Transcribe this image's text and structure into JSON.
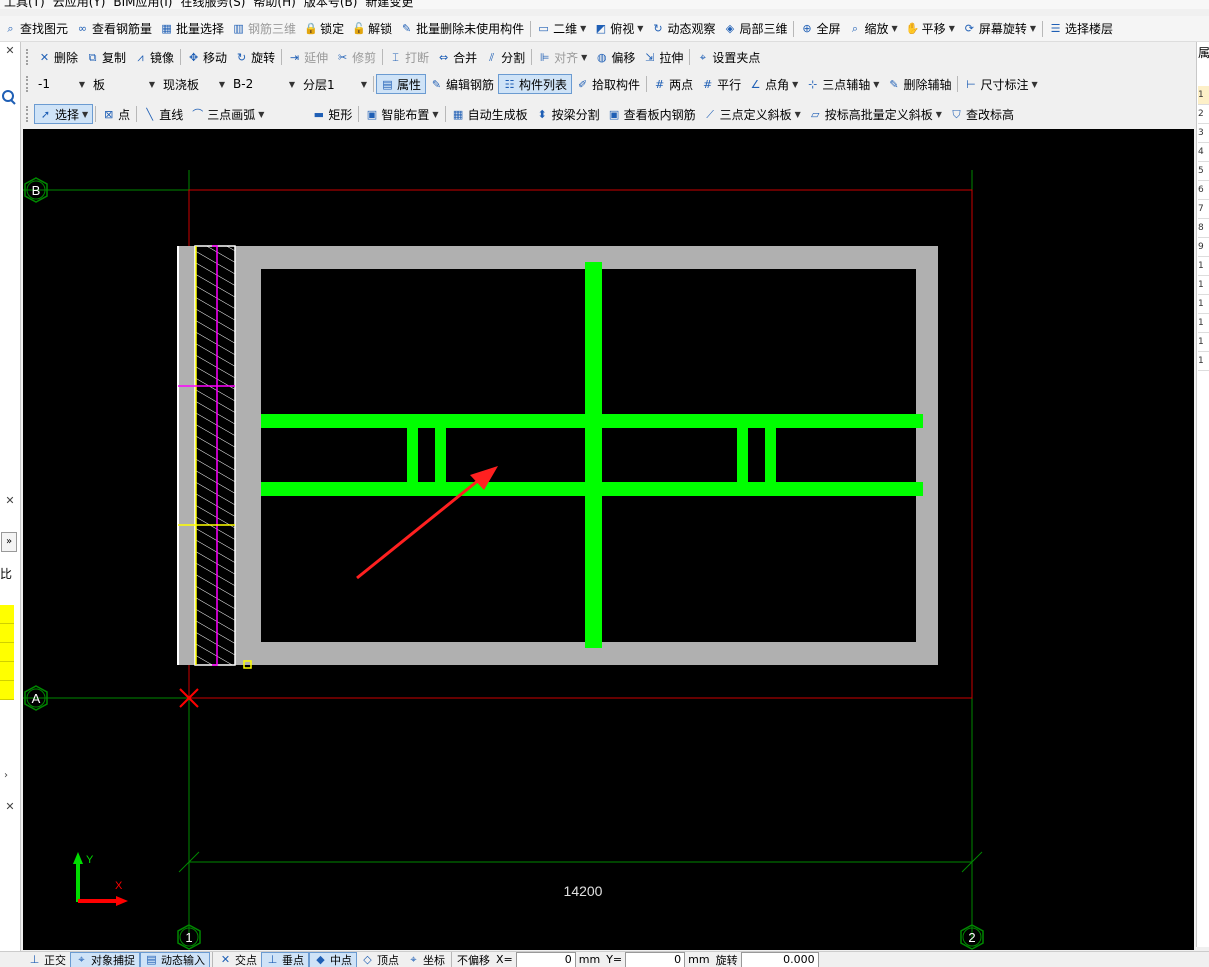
{
  "menubar": [
    "工具(T)",
    "云应用(Y)",
    "BIM应用(I)",
    "在线服务(S)",
    "帮助(H)",
    "版本号(B)",
    "新建变更"
  ],
  "toolbar1": [
    {
      "label": "查找图元",
      "icon": "binoculars-icon"
    },
    {
      "label": "查看钢筋量",
      "icon": "glasses-icon"
    },
    {
      "label": "批量选择",
      "icon": "grid-select-icon"
    },
    {
      "label": "钢筋三维",
      "icon": "rebar-3d-icon",
      "disabled": true
    },
    {
      "label": "锁定",
      "icon": "lock-icon"
    },
    {
      "label": "解锁",
      "icon": "unlock-icon"
    },
    {
      "label": "批量删除未使用构件",
      "icon": "brush-icon"
    },
    {
      "label": "二维",
      "icon": "square-icon",
      "dropdown": true
    },
    {
      "label": "俯视",
      "icon": "cube-icon",
      "dropdown": true
    },
    {
      "label": "动态观察",
      "icon": "orbit-icon"
    },
    {
      "label": "局部三维",
      "icon": "local-3d-icon"
    },
    {
      "label": "全屏",
      "icon": "zoom-full-icon"
    },
    {
      "label": "缩放",
      "icon": "zoom-icon",
      "dropdown": true
    },
    {
      "label": "平移",
      "icon": "pan-hand-icon",
      "dropdown": true
    },
    {
      "label": "屏幕旋转",
      "icon": "rotate-screen-icon",
      "dropdown": true
    },
    {
      "label": "选择楼层",
      "icon": "floor-select-icon"
    }
  ],
  "toolbar2": [
    {
      "label": "删除",
      "icon": "delete-icon"
    },
    {
      "label": "复制",
      "icon": "copy-icon"
    },
    {
      "label": "镜像",
      "icon": "mirror-icon"
    },
    {
      "label": "移动",
      "icon": "move-icon"
    },
    {
      "label": "旋转",
      "icon": "rotate-icon"
    },
    {
      "label": "延伸",
      "icon": "extend-icon",
      "disabled": true
    },
    {
      "label": "修剪",
      "icon": "trim-icon",
      "disabled": true
    },
    {
      "label": "打断",
      "icon": "break-icon",
      "disabled": true
    },
    {
      "label": "合并",
      "icon": "merge-icon"
    },
    {
      "label": "分割",
      "icon": "split-icon"
    },
    {
      "label": "对齐",
      "icon": "align-icon",
      "disabled": true,
      "dropdown": true
    },
    {
      "label": "偏移",
      "icon": "offset-icon"
    },
    {
      "label": "拉伸",
      "icon": "stretch-icon"
    },
    {
      "label": "设置夹点",
      "icon": "grip-point-icon"
    }
  ],
  "toolbar3": {
    "floor": "-1",
    "category": "板",
    "type": "现浇板",
    "component": "B-2",
    "layer": "分层1",
    "buttons": [
      {
        "label": "属性",
        "icon": "properties-icon",
        "active": true
      },
      {
        "label": "编辑钢筋",
        "icon": "edit-rebar-icon"
      },
      {
        "label": "构件列表",
        "icon": "component-list-icon",
        "active": true
      },
      {
        "label": "拾取构件",
        "icon": "pick-icon"
      },
      {
        "label": "两点",
        "icon": "two-point-icon"
      },
      {
        "label": "平行",
        "icon": "parallel-icon"
      },
      {
        "label": "点角",
        "icon": "point-angle-icon",
        "dropdown": true
      },
      {
        "label": "三点辅轴",
        "icon": "three-point-axis-icon",
        "dropdown": true
      },
      {
        "label": "删除辅轴",
        "icon": "delete-axis-icon"
      },
      {
        "label": "尺寸标注",
        "icon": "dimension-icon",
        "dropdown": true
      }
    ]
  },
  "toolbar4": [
    {
      "label": "选择",
      "icon": "cursor-icon",
      "active": true,
      "dropdown": true
    },
    {
      "label": "点",
      "icon": "point-icon"
    },
    {
      "label": "直线",
      "icon": "line-icon"
    },
    {
      "label": "三点画弧",
      "icon": "arc-icon",
      "dropdown": true
    },
    {
      "label": "矩形",
      "icon": "rectangle-icon"
    },
    {
      "label": "智能布置",
      "icon": "smart-layout-icon",
      "dropdown": true
    },
    {
      "label": "自动生成板",
      "icon": "auto-slab-icon"
    },
    {
      "label": "按梁分割",
      "icon": "beam-split-icon"
    },
    {
      "label": "查看板内钢筋",
      "icon": "view-rebar-icon"
    },
    {
      "label": "三点定义斜板",
      "icon": "slope-slab-icon",
      "dropdown": true
    },
    {
      "label": "按标高批量定义斜板",
      "icon": "batch-slope-icon",
      "dropdown": true
    },
    {
      "label": "查改标高",
      "icon": "elevation-icon"
    }
  ],
  "drawing": {
    "axis_labels": {
      "b": "B",
      "a": "A",
      "one": "1",
      "two": "2"
    },
    "dimension": "14200",
    "ucs": {
      "y": "Y",
      "x": "X"
    },
    "colors": {
      "background": "#000000",
      "slab": "#b0b0b0",
      "rebar": "#00ff00",
      "grid": "#008800",
      "boundary": "#cc0000",
      "arrow": "#ff2020",
      "hatch": "#ffffff",
      "magenta": "#ff00ff",
      "yellow": "#ffff00"
    }
  },
  "left_panel": {
    "expand": "»",
    "label": "比"
  },
  "right_panel": {
    "header": "属",
    "rows": [
      "1",
      "2",
      "3",
      "4",
      "5",
      "6",
      "7",
      "8",
      "9",
      "1",
      "1",
      "1",
      "1",
      "1",
      "1"
    ]
  },
  "statusbar": {
    "items": [
      {
        "label": "正交",
        "icon": "ortho-icon"
      },
      {
        "label": "对象捕捉",
        "icon": "snap-icon",
        "active": true
      },
      {
        "label": "动态输入",
        "icon": "dynamic-input-icon",
        "active": true
      },
      {
        "label": "交点",
        "icon": "intersection-icon"
      },
      {
        "label": "垂点",
        "icon": "perpendicular-icon",
        "active": true
      },
      {
        "label": "中点",
        "icon": "midpoint-icon",
        "active": true
      },
      {
        "label": "顶点",
        "icon": "vertex-icon"
      },
      {
        "label": "坐标",
        "icon": "coordinate-icon"
      }
    ],
    "offset_mode": "不偏移",
    "x_label": "X=",
    "x_value": "0",
    "y_label": "Y=",
    "y_value": "0",
    "unit": "mm",
    "rotate_label": "旋转",
    "rotate_value": "0.000"
  }
}
